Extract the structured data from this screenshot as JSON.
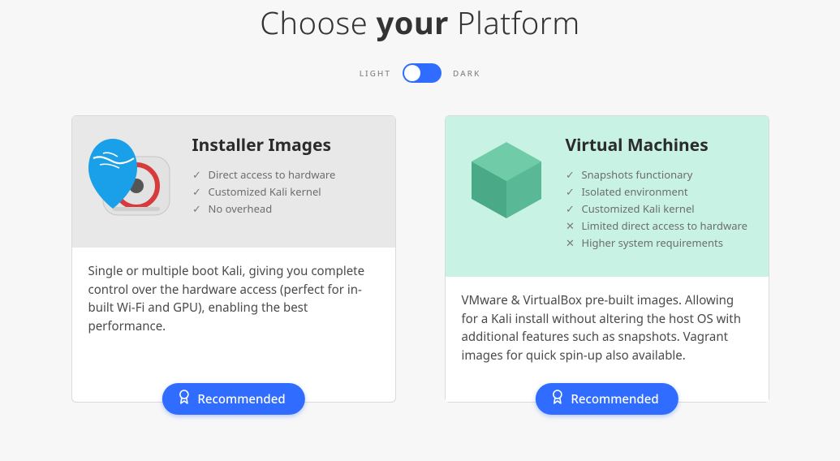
{
  "heading": {
    "pre": "Choose ",
    "bold": "your",
    "post": " Platform"
  },
  "theme": {
    "light": "LIGHT",
    "dark": "DARK"
  },
  "cards": [
    {
      "title": "Installer Images",
      "features": [
        {
          "mark": "check",
          "text": "Direct access to hardware"
        },
        {
          "mark": "check",
          "text": "Customized Kali kernel"
        },
        {
          "mark": "check",
          "text": "No overhead"
        }
      ],
      "description": "Single or multiple boot Kali, giving you complete control over the hardware access (perfect for in-built Wi-Fi and GPU), enabling the best performance.",
      "badge": "Recommended"
    },
    {
      "title": "Virtual Machines",
      "features": [
        {
          "mark": "check",
          "text": "Snapshots functionary"
        },
        {
          "mark": "check",
          "text": "Isolated environment"
        },
        {
          "mark": "check",
          "text": "Customized Kali kernel"
        },
        {
          "mark": "cross",
          "text": "Limited direct access to hardware"
        },
        {
          "mark": "cross",
          "text": "Higher system requirements"
        }
      ],
      "description": "VMware & VirtualBox pre-built images. Allowing for a Kali install without altering the host OS with additional features such as snapshots. Vagrant images for quick spin-up also available.",
      "badge": "Recommended"
    }
  ]
}
